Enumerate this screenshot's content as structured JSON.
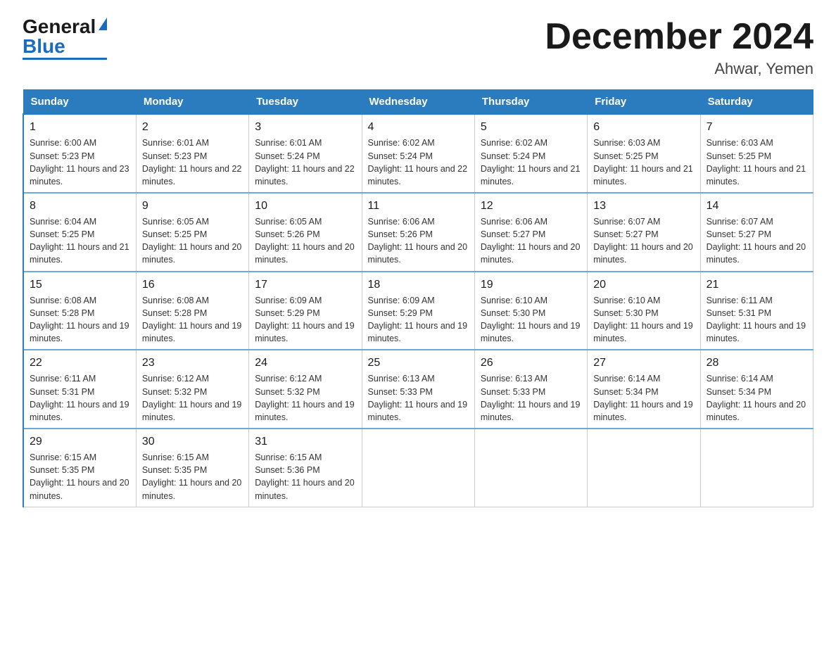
{
  "logo": {
    "general": "General",
    "blue": "Blue"
  },
  "title": "December 2024",
  "subtitle": "Ahwar, Yemen",
  "days_of_week": [
    "Sunday",
    "Monday",
    "Tuesday",
    "Wednesday",
    "Thursday",
    "Friday",
    "Saturday"
  ],
  "weeks": [
    [
      {
        "day": "1",
        "sunrise": "6:00 AM",
        "sunset": "5:23 PM",
        "daylight": "11 hours and 23 minutes."
      },
      {
        "day": "2",
        "sunrise": "6:01 AM",
        "sunset": "5:23 PM",
        "daylight": "11 hours and 22 minutes."
      },
      {
        "day": "3",
        "sunrise": "6:01 AM",
        "sunset": "5:24 PM",
        "daylight": "11 hours and 22 minutes."
      },
      {
        "day": "4",
        "sunrise": "6:02 AM",
        "sunset": "5:24 PM",
        "daylight": "11 hours and 22 minutes."
      },
      {
        "day": "5",
        "sunrise": "6:02 AM",
        "sunset": "5:24 PM",
        "daylight": "11 hours and 21 minutes."
      },
      {
        "day": "6",
        "sunrise": "6:03 AM",
        "sunset": "5:25 PM",
        "daylight": "11 hours and 21 minutes."
      },
      {
        "day": "7",
        "sunrise": "6:03 AM",
        "sunset": "5:25 PM",
        "daylight": "11 hours and 21 minutes."
      }
    ],
    [
      {
        "day": "8",
        "sunrise": "6:04 AM",
        "sunset": "5:25 PM",
        "daylight": "11 hours and 21 minutes."
      },
      {
        "day": "9",
        "sunrise": "6:05 AM",
        "sunset": "5:25 PM",
        "daylight": "11 hours and 20 minutes."
      },
      {
        "day": "10",
        "sunrise": "6:05 AM",
        "sunset": "5:26 PM",
        "daylight": "11 hours and 20 minutes."
      },
      {
        "day": "11",
        "sunrise": "6:06 AM",
        "sunset": "5:26 PM",
        "daylight": "11 hours and 20 minutes."
      },
      {
        "day": "12",
        "sunrise": "6:06 AM",
        "sunset": "5:27 PM",
        "daylight": "11 hours and 20 minutes."
      },
      {
        "day": "13",
        "sunrise": "6:07 AM",
        "sunset": "5:27 PM",
        "daylight": "11 hours and 20 minutes."
      },
      {
        "day": "14",
        "sunrise": "6:07 AM",
        "sunset": "5:27 PM",
        "daylight": "11 hours and 20 minutes."
      }
    ],
    [
      {
        "day": "15",
        "sunrise": "6:08 AM",
        "sunset": "5:28 PM",
        "daylight": "11 hours and 19 minutes."
      },
      {
        "day": "16",
        "sunrise": "6:08 AM",
        "sunset": "5:28 PM",
        "daylight": "11 hours and 19 minutes."
      },
      {
        "day": "17",
        "sunrise": "6:09 AM",
        "sunset": "5:29 PM",
        "daylight": "11 hours and 19 minutes."
      },
      {
        "day": "18",
        "sunrise": "6:09 AM",
        "sunset": "5:29 PM",
        "daylight": "11 hours and 19 minutes."
      },
      {
        "day": "19",
        "sunrise": "6:10 AM",
        "sunset": "5:30 PM",
        "daylight": "11 hours and 19 minutes."
      },
      {
        "day": "20",
        "sunrise": "6:10 AM",
        "sunset": "5:30 PM",
        "daylight": "11 hours and 19 minutes."
      },
      {
        "day": "21",
        "sunrise": "6:11 AM",
        "sunset": "5:31 PM",
        "daylight": "11 hours and 19 minutes."
      }
    ],
    [
      {
        "day": "22",
        "sunrise": "6:11 AM",
        "sunset": "5:31 PM",
        "daylight": "11 hours and 19 minutes."
      },
      {
        "day": "23",
        "sunrise": "6:12 AM",
        "sunset": "5:32 PM",
        "daylight": "11 hours and 19 minutes."
      },
      {
        "day": "24",
        "sunrise": "6:12 AM",
        "sunset": "5:32 PM",
        "daylight": "11 hours and 19 minutes."
      },
      {
        "day": "25",
        "sunrise": "6:13 AM",
        "sunset": "5:33 PM",
        "daylight": "11 hours and 19 minutes."
      },
      {
        "day": "26",
        "sunrise": "6:13 AM",
        "sunset": "5:33 PM",
        "daylight": "11 hours and 19 minutes."
      },
      {
        "day": "27",
        "sunrise": "6:14 AM",
        "sunset": "5:34 PM",
        "daylight": "11 hours and 19 minutes."
      },
      {
        "day": "28",
        "sunrise": "6:14 AM",
        "sunset": "5:34 PM",
        "daylight": "11 hours and 20 minutes."
      }
    ],
    [
      {
        "day": "29",
        "sunrise": "6:15 AM",
        "sunset": "5:35 PM",
        "daylight": "11 hours and 20 minutes."
      },
      {
        "day": "30",
        "sunrise": "6:15 AM",
        "sunset": "5:35 PM",
        "daylight": "11 hours and 20 minutes."
      },
      {
        "day": "31",
        "sunrise": "6:15 AM",
        "sunset": "5:36 PM",
        "daylight": "11 hours and 20 minutes."
      },
      null,
      null,
      null,
      null
    ]
  ],
  "labels": {
    "sunrise": "Sunrise:",
    "sunset": "Sunset:",
    "daylight": "Daylight:"
  }
}
